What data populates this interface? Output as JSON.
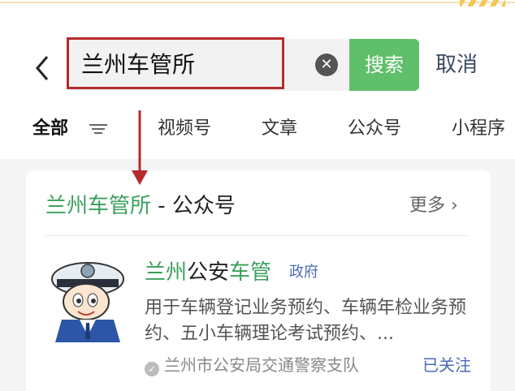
{
  "header": {
    "back_icon": "chevron-left-icon",
    "search": {
      "query": "兰州车管所",
      "clear_icon": "clear-circle-icon"
    },
    "search_button": "搜索",
    "cancel": "取消"
  },
  "tabs": [
    {
      "label": "全部",
      "active": true
    },
    {
      "label": "视频号"
    },
    {
      "label": "文章"
    },
    {
      "label": "公众号"
    },
    {
      "label": "小程序"
    }
  ],
  "card": {
    "title_highlight": "兰州车管所",
    "title_rest": " - 公众号",
    "more": "更多",
    "account": {
      "name_part1": "兰州",
      "name_part2": "公安",
      "name_part3": "车管",
      "badge": "政府",
      "description": "用于车辆登记业务预约、车辆年检业务预约、五小车辆理论考试预约、...",
      "verified_by": "兰州市公安局交通警察支队",
      "follow_status": "已关注"
    }
  },
  "colors": {
    "accent_green": "#5fbf6a",
    "highlight_green": "#3aa05c",
    "annotation_red": "#b52b2b",
    "link_blue": "#4a6bb5"
  }
}
